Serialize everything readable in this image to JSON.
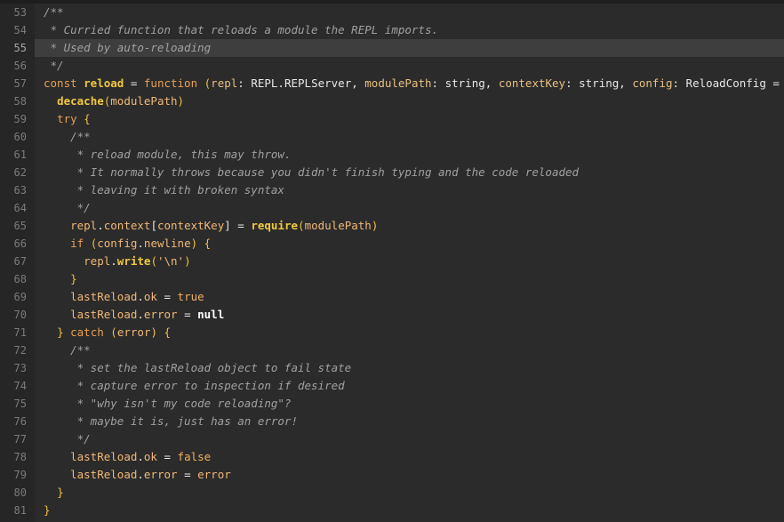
{
  "editor": {
    "language": "typescript",
    "active_line": "55",
    "colors": {
      "background": "#2b2b2b",
      "gutter": "#262626",
      "active_line": "#3e3e3e",
      "comment": "#a0a0a0",
      "keyword": "#e8a050",
      "function": "#f0c840",
      "text": "#e6e6e6"
    },
    "lines": [
      {
        "n": "53",
        "tokens": [
          {
            "t": "/**",
            "c": "comment"
          }
        ]
      },
      {
        "n": "54",
        "tokens": [
          {
            "t": " * Curried function that reloads a module the REPL imports.",
            "c": "comment"
          }
        ]
      },
      {
        "n": "55",
        "tokens": [
          {
            "t": " * Used by auto-reloading",
            "c": "comment"
          }
        ]
      },
      {
        "n": "56",
        "tokens": [
          {
            "t": " */",
            "c": "comment"
          }
        ]
      },
      {
        "n": "57",
        "tokens": [
          {
            "t": "const ",
            "c": "kw"
          },
          {
            "t": "reload",
            "c": "fn"
          },
          {
            "t": " = ",
            "c": "op"
          },
          {
            "t": "function",
            "c": "kw"
          },
          {
            "t": " ",
            "c": "op"
          },
          {
            "t": "(",
            "c": "paren"
          },
          {
            "t": "repl",
            "c": "param"
          },
          {
            "t": ": REPL.REPLServer, ",
            "c": "type"
          },
          {
            "t": "modulePath",
            "c": "param"
          },
          {
            "t": ": string, ",
            "c": "type"
          },
          {
            "t": "contextKey",
            "c": "param"
          },
          {
            "t": ": string, ",
            "c": "type"
          },
          {
            "t": "config",
            "c": "param"
          },
          {
            "t": ": ReloadConfig = ",
            "c": "type"
          },
          {
            "t": "{}",
            "c": "paren"
          },
          {
            "t": ") {",
            "c": "paren"
          }
        ]
      },
      {
        "n": "58",
        "tokens": [
          {
            "t": "  ",
            "c": "op"
          },
          {
            "t": "decache",
            "c": "fn"
          },
          {
            "t": "(",
            "c": "paren"
          },
          {
            "t": "modulePath",
            "c": "var"
          },
          {
            "t": ")",
            "c": "paren"
          }
        ]
      },
      {
        "n": "59",
        "tokens": [
          {
            "t": "  ",
            "c": "op"
          },
          {
            "t": "try",
            "c": "kw"
          },
          {
            "t": " {",
            "c": "paren"
          }
        ]
      },
      {
        "n": "60",
        "tokens": [
          {
            "t": "    /**",
            "c": "comment"
          }
        ]
      },
      {
        "n": "61",
        "tokens": [
          {
            "t": "     * reload module, this may throw.",
            "c": "comment"
          }
        ]
      },
      {
        "n": "62",
        "tokens": [
          {
            "t": "     * It normally throws because you didn't finish typing and the code reloaded",
            "c": "comment"
          }
        ]
      },
      {
        "n": "63",
        "tokens": [
          {
            "t": "     * leaving it with broken syntax",
            "c": "comment"
          }
        ]
      },
      {
        "n": "64",
        "tokens": [
          {
            "t": "     */",
            "c": "comment"
          }
        ]
      },
      {
        "n": "65",
        "tokens": [
          {
            "t": "    ",
            "c": "op"
          },
          {
            "t": "repl",
            "c": "var"
          },
          {
            "t": ".",
            "c": "op"
          },
          {
            "t": "context",
            "c": "var"
          },
          {
            "t": "[",
            "c": "op"
          },
          {
            "t": "contextKey",
            "c": "var"
          },
          {
            "t": "] = ",
            "c": "op"
          },
          {
            "t": "require",
            "c": "fn"
          },
          {
            "t": "(",
            "c": "paren"
          },
          {
            "t": "modulePath",
            "c": "var"
          },
          {
            "t": ")",
            "c": "paren"
          }
        ]
      },
      {
        "n": "66",
        "tokens": [
          {
            "t": "    ",
            "c": "op"
          },
          {
            "t": "if",
            "c": "kw"
          },
          {
            "t": " (",
            "c": "paren"
          },
          {
            "t": "config",
            "c": "var"
          },
          {
            "t": ".",
            "c": "op"
          },
          {
            "t": "newline",
            "c": "var"
          },
          {
            "t": ") {",
            "c": "paren"
          }
        ]
      },
      {
        "n": "67",
        "tokens": [
          {
            "t": "      ",
            "c": "op"
          },
          {
            "t": "repl",
            "c": "var"
          },
          {
            "t": ".",
            "c": "op"
          },
          {
            "t": "write",
            "c": "fn"
          },
          {
            "t": "(",
            "c": "paren"
          },
          {
            "t": "'\\n'",
            "c": "str"
          },
          {
            "t": ")",
            "c": "paren"
          }
        ]
      },
      {
        "n": "68",
        "tokens": [
          {
            "t": "    ",
            "c": "op"
          },
          {
            "t": "}",
            "c": "paren"
          }
        ]
      },
      {
        "n": "69",
        "tokens": [
          {
            "t": "    ",
            "c": "op"
          },
          {
            "t": "lastReload",
            "c": "var"
          },
          {
            "t": ".",
            "c": "op"
          },
          {
            "t": "ok",
            "c": "var"
          },
          {
            "t": " = ",
            "c": "op"
          },
          {
            "t": "true",
            "c": "bool"
          }
        ]
      },
      {
        "n": "70",
        "tokens": [
          {
            "t": "    ",
            "c": "op"
          },
          {
            "t": "lastReload",
            "c": "var"
          },
          {
            "t": ".",
            "c": "op"
          },
          {
            "t": "error",
            "c": "var"
          },
          {
            "t": " = ",
            "c": "op"
          },
          {
            "t": "null",
            "c": "null"
          }
        ]
      },
      {
        "n": "71",
        "tokens": [
          {
            "t": "  ",
            "c": "op"
          },
          {
            "t": "} ",
            "c": "paren"
          },
          {
            "t": "catch",
            "c": "kw"
          },
          {
            "t": " (",
            "c": "paren"
          },
          {
            "t": "error",
            "c": "var"
          },
          {
            "t": ") {",
            "c": "paren"
          }
        ]
      },
      {
        "n": "72",
        "tokens": [
          {
            "t": "    /**",
            "c": "comment"
          }
        ]
      },
      {
        "n": "73",
        "tokens": [
          {
            "t": "     * set the lastReload object to fail state",
            "c": "comment"
          }
        ]
      },
      {
        "n": "74",
        "tokens": [
          {
            "t": "     * capture error to inspection if desired",
            "c": "comment"
          }
        ]
      },
      {
        "n": "75",
        "tokens": [
          {
            "t": "     * \"why isn't my code reloading\"?",
            "c": "comment"
          }
        ]
      },
      {
        "n": "76",
        "tokens": [
          {
            "t": "     * maybe it is, just has an error!",
            "c": "comment"
          }
        ]
      },
      {
        "n": "77",
        "tokens": [
          {
            "t": "     */",
            "c": "comment"
          }
        ]
      },
      {
        "n": "78",
        "tokens": [
          {
            "t": "    ",
            "c": "op"
          },
          {
            "t": "lastReload",
            "c": "var"
          },
          {
            "t": ".",
            "c": "op"
          },
          {
            "t": "ok",
            "c": "var"
          },
          {
            "t": " = ",
            "c": "op"
          },
          {
            "t": "false",
            "c": "bool"
          }
        ]
      },
      {
        "n": "79",
        "tokens": [
          {
            "t": "    ",
            "c": "op"
          },
          {
            "t": "lastReload",
            "c": "var"
          },
          {
            "t": ".",
            "c": "op"
          },
          {
            "t": "error",
            "c": "var"
          },
          {
            "t": " = ",
            "c": "op"
          },
          {
            "t": "error",
            "c": "var"
          }
        ]
      },
      {
        "n": "80",
        "tokens": [
          {
            "t": "  ",
            "c": "op"
          },
          {
            "t": "}",
            "c": "paren"
          }
        ]
      },
      {
        "n": "81",
        "tokens": [
          {
            "t": "}",
            "c": "paren"
          }
        ]
      }
    ]
  }
}
